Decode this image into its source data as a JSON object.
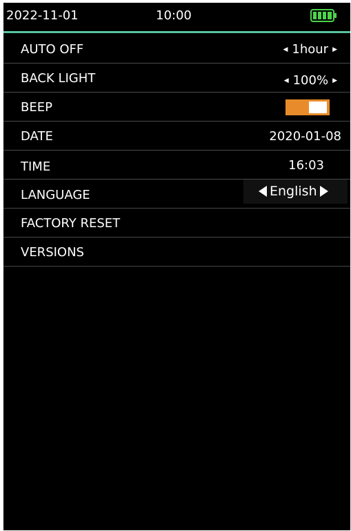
{
  "status": {
    "date": "2022-11-01",
    "time": "10:00",
    "battery_icon": "battery-full-icon",
    "battery_color": "#4bd44b",
    "accent_line_color": "#58c49c"
  },
  "settings": [
    {
      "label": "AUTO OFF",
      "value": "1hour",
      "type": "selector"
    },
    {
      "label": "BACK LIGHT",
      "value": "100%",
      "type": "selector"
    },
    {
      "label": "BEEP",
      "state": "on",
      "type": "toggle",
      "color": "#e88c2b"
    },
    {
      "label": "DATE",
      "value": "2020-01-08",
      "type": "value"
    },
    {
      "label": "TIME",
      "value": "16:03",
      "type": "value"
    },
    {
      "label": "LANGUAGE",
      "value": "English",
      "type": "selector"
    },
    {
      "label": "FACTORY RESET",
      "type": "action"
    },
    {
      "label": "VERSIONS",
      "type": "action"
    }
  ]
}
